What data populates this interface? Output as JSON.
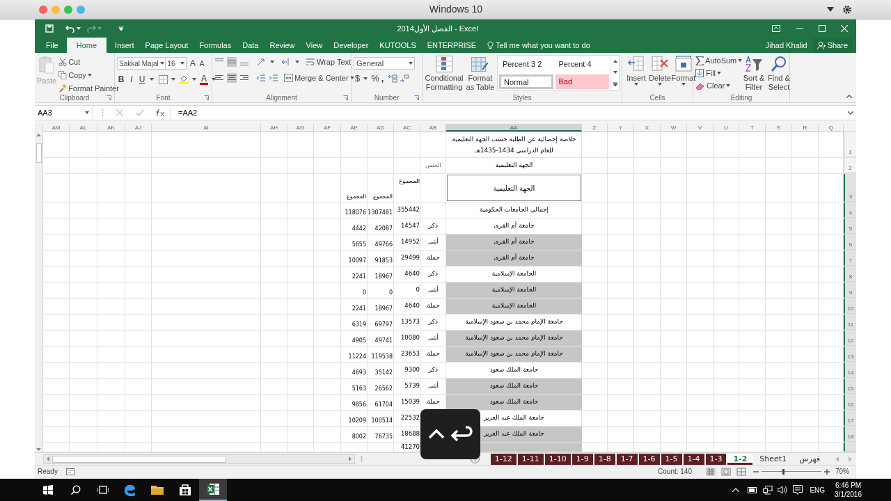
{
  "mac_window": {
    "title": "Windows 10"
  },
  "excel": {
    "title": "الفصل الأول2014 - Excel",
    "tabs": [
      {
        "label": "File",
        "selected": false
      },
      {
        "label": "Home",
        "selected": true
      },
      {
        "label": "Insert",
        "selected": false
      },
      {
        "label": "Page Layout",
        "selected": false
      },
      {
        "label": "Formulas",
        "selected": false
      },
      {
        "label": "Data",
        "selected": false
      },
      {
        "label": "Review",
        "selected": false
      },
      {
        "label": "View",
        "selected": false
      },
      {
        "label": "Developer",
        "selected": false
      },
      {
        "label": "KUTOOLS",
        "selected": false
      },
      {
        "label": "ENTERPRISE",
        "selected": false
      }
    ],
    "tell_me": "Tell me what you want to do",
    "user": "Jihad Khalid",
    "share": "Share",
    "ribbon": {
      "clipboard": {
        "label": "Clipboard",
        "paste": "Paste",
        "cut": "Cut",
        "copy": "Copy",
        "format_painter": "Format Painter"
      },
      "font": {
        "label": "Font",
        "name": "Sakkal Majal",
        "size": "16",
        "grow_shrink": [
          "A",
          "A"
        ],
        "styles": [
          "B",
          "I",
          "U"
        ],
        "color_letter": "A"
      },
      "alignment": {
        "label": "Alignment",
        "wrap_text": "Wrap Text",
        "merge_center": "Merge & Center"
      },
      "number": {
        "label": "Number",
        "format": "General",
        "symbols": [
          "$",
          "%",
          ","
        ]
      },
      "styles": {
        "label": "Styles",
        "conditional_formatting": "Conditional Formatting",
        "format_as_table": "Format as Table",
        "gallery": [
          {
            "label": "Percent 3 2",
            "color": "#ffffff",
            "selected": false
          },
          {
            "label": "Percent 4",
            "color": "#ffffff",
            "selected": false
          },
          {
            "label": "Normal",
            "color": "#ffffff",
            "selected": true
          },
          {
            "label": "Bad",
            "color": "#ffc7ce",
            "selected": false
          }
        ]
      },
      "cells": {
        "label": "Cells",
        "buttons": [
          "Insert",
          "Delete",
          "Format"
        ]
      },
      "editing": {
        "label": "Editing",
        "autosum": "AutoSum",
        "fill": "Fill",
        "clear": "Clear",
        "sort_filter": "Sort & Filter",
        "find_select": "Find & Select"
      }
    },
    "formula_bar": {
      "name_box": "AA3",
      "formula": "=AA2"
    },
    "columns": [
      {
        "label": "AM",
        "selected": false
      },
      {
        "label": "AL",
        "selected": false
      },
      {
        "label": "AK",
        "selected": false
      },
      {
        "label": "AJ",
        "selected": false
      },
      {
        "label": "AI",
        "selected": false
      },
      {
        "label": "AH",
        "selected": false
      },
      {
        "label": "AG",
        "selected": false
      },
      {
        "label": "AF",
        "selected": false
      },
      {
        "label": "AE",
        "selected": false
      },
      {
        "label": "AD",
        "selected": false
      },
      {
        "label": "AC",
        "selected": false
      },
      {
        "label": "AB",
        "selected": false
      },
      {
        "label": "AA",
        "selected": true
      },
      {
        "label": "Z",
        "selected": false
      },
      {
        "label": "Y",
        "selected": false
      },
      {
        "label": "X",
        "selected": false
      },
      {
        "label": "W",
        "selected": false
      },
      {
        "label": "V",
        "selected": false
      },
      {
        "label": "U",
        "selected": false
      },
      {
        "label": "T",
        "selected": false
      },
      {
        "label": "S",
        "selected": false
      },
      {
        "label": "R",
        "selected": false
      },
      {
        "label": "Q",
        "selected": false
      }
    ],
    "rows": [
      {
        "number": "1",
        "selected": false,
        "shaded": false,
        "boxed": false,
        "aa_lines": [
          "خلاصة إحصائية عن الطلبة حسب الجهة التعليمية",
          "للعام الدراسي 1434-1435هـ"
        ]
      },
      {
        "number": "2",
        "selected": false,
        "shaded": false,
        "boxed": false,
        "aa": "الجهة التعليمية",
        "ab": "الجنس"
      },
      {
        "number": "3",
        "selected": true,
        "shaded": false,
        "boxed": true,
        "aa": "الجهة التعليمية",
        "ac": "المجموع",
        "ad": "المجموع",
        "ae": "المجموع"
      },
      {
        "number": "4",
        "selected": true,
        "shaded": false,
        "boxed": false,
        "aa": "إجمالي الجامعات الحكومية",
        "ac": "355442",
        "ad": "1307481",
        "ae": "118076"
      },
      {
        "number": "5",
        "selected": true,
        "shaded": false,
        "boxed": false,
        "aa": "جامعة أم القرى",
        "ab": "ذكر",
        "ac": "14547",
        "ad": "42087",
        "ae": "4442"
      },
      {
        "number": "6",
        "selected": true,
        "shaded": true,
        "boxed": false,
        "aa": "جامعة أم القرى",
        "ab": "أنثى",
        "ac": "14952",
        "ad": "49766",
        "ae": "5655"
      },
      {
        "number": "7",
        "selected": true,
        "shaded": true,
        "boxed": false,
        "aa": "جامعة أم القرى",
        "ab": "جملة",
        "ac": "29499",
        "ad": "91853",
        "ae": "10097"
      },
      {
        "number": "8",
        "selected": true,
        "shaded": false,
        "boxed": false,
        "aa": "الجامعة الإسلامية",
        "ab": "ذكر",
        "ac": "4640",
        "ad": "18967",
        "ae": "2241"
      },
      {
        "number": "9",
        "selected": true,
        "shaded": true,
        "boxed": false,
        "aa": "الجامعة الإسلامية",
        "ab": "أنثى",
        "ac": "0",
        "ad": "0",
        "ae": "0"
      },
      {
        "number": "10",
        "selected": true,
        "shaded": true,
        "boxed": false,
        "aa": "الجامعة الإسلامية",
        "ab": "جملة",
        "ac": "4640",
        "ad": "18967",
        "ae": "2241"
      },
      {
        "number": "11",
        "selected": true,
        "shaded": false,
        "boxed": false,
        "aa": "جامعة الإمام محمد بن سعود الإسلامية",
        "ab": "ذكر",
        "ac": "13573",
        "ad": "69797",
        "ae": "6319"
      },
      {
        "number": "12",
        "selected": true,
        "shaded": true,
        "boxed": false,
        "aa": "جامعة الإمام محمد بن سعود الإسلامية",
        "ab": "أنثى",
        "ac": "10080",
        "ad": "49741",
        "ae": "4905"
      },
      {
        "number": "13",
        "selected": true,
        "shaded": true,
        "boxed": false,
        "aa": "جامعة الإمام محمد بن سعود الإسلامية",
        "ab": "جملة",
        "ac": "23653",
        "ad": "119538",
        "ae": "11224"
      },
      {
        "number": "14",
        "selected": true,
        "shaded": false,
        "boxed": false,
        "aa": "جامعة الملك سعود",
        "ab": "ذكر",
        "ac": "9300",
        "ad": "35142",
        "ae": "4693"
      },
      {
        "number": "15",
        "selected": true,
        "shaded": true,
        "boxed": false,
        "aa": "جامعة الملك سعود",
        "ab": "أنثى",
        "ac": "5739",
        "ad": "26562",
        "ae": "5163"
      },
      {
        "number": "16",
        "selected": true,
        "shaded": true,
        "boxed": false,
        "aa": "جامعة الملك سعود",
        "ab": "جملة",
        "ac": "15039",
        "ad": "61704",
        "ae": "9856"
      },
      {
        "number": "17",
        "selected": true,
        "shaded": false,
        "boxed": false,
        "aa": "جامعة الملك عبد العزيز",
        "ac": "22532",
        "ad": "100514",
        "ae": "10209"
      },
      {
        "number": "18",
        "selected": true,
        "shaded": true,
        "boxed": false,
        "aa": "جامعة الملك عبد العزيز",
        "ac": "18688",
        "ad": "76735",
        "ae": "8002"
      },
      {
        "selected": true,
        "shaded": true,
        "boxed": false,
        "ac": "41270"
      }
    ],
    "sheet_tabs": [
      {
        "label": "1-12",
        "selected": false,
        "color": "#5c1f24"
      },
      {
        "label": "1-11",
        "selected": false,
        "color": "#5c1f24"
      },
      {
        "label": "1-10",
        "selected": false,
        "color": "#5c1f24"
      },
      {
        "label": "1-9",
        "selected": false,
        "color": "#5c1f24"
      },
      {
        "label": "1-8",
        "selected": false,
        "color": "#5c1f24"
      },
      {
        "label": "1-7",
        "selected": false,
        "color": "#5c1f24"
      },
      {
        "label": "1-6",
        "selected": false,
        "color": "#5c1f24"
      },
      {
        "label": "1-5",
        "selected": false,
        "color": "#5c1f24"
      },
      {
        "label": "1-4",
        "selected": false,
        "color": "#5c1f24"
      },
      {
        "label": "1-3",
        "selected": false,
        "color": "#5c1f24"
      },
      {
        "label": "1-2",
        "selected": true,
        "color": "#5c1f24"
      },
      {
        "label": "Sheet1",
        "selected": false,
        "color": "#f0f0f0"
      },
      {
        "label": "فهرس",
        "selected": false,
        "color": "#f0f0f0"
      }
    ],
    "status_bar": {
      "mode": "Ready",
      "count": "Count: 140",
      "zoom": "70%",
      "zoom_slider": {
        "level": 0.36
      }
    }
  },
  "taskbar": {
    "apps": [
      {
        "kind": "edge",
        "selected": false
      },
      {
        "kind": "explorer",
        "selected": false
      },
      {
        "kind": "store",
        "selected": false
      },
      {
        "kind": "excel",
        "selected": true
      }
    ],
    "language": "ENG",
    "time": "6:46 PM",
    "date": "3/1/2016"
  }
}
